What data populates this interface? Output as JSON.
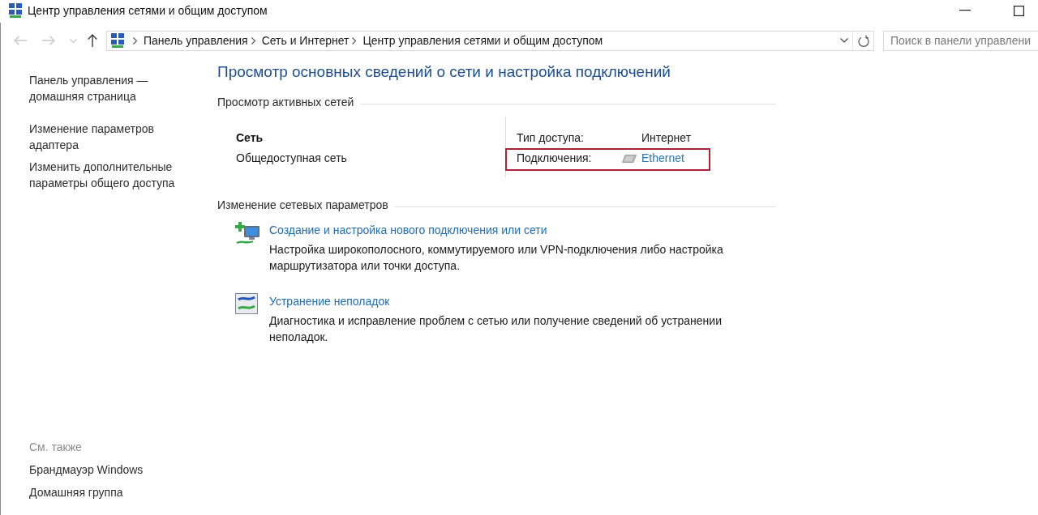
{
  "window": {
    "title": "Центр управления сетями и общим доступом"
  },
  "navigation": [
    {
      "kind": "back",
      "disabled": true
    },
    {
      "kind": "forward",
      "disabled": true
    },
    {
      "kind": "recent",
      "disabled": true
    },
    {
      "kind": "up",
      "disabled": false
    }
  ],
  "address_bar": {
    "breadcrumbs": [
      "Панель управления",
      "Сеть и Интернет",
      "Центр управления сетями и общим доступом"
    ]
  },
  "search": {
    "placeholder": "Поиск в панели управлени"
  },
  "sidebar": {
    "links": [
      "Панель управления — домашняя страница",
      "Изменение параметров адаптера",
      "Изменить дополнительные параметры общего доступа"
    ],
    "see_also": {
      "title": "См. также",
      "links": [
        "Брандмауэр Windows",
        "Домашняя группа"
      ]
    }
  },
  "main": {
    "title": "Просмотр основных сведений о сети и настройка подключений",
    "active_networks": {
      "heading": "Просмотр активных сетей",
      "network": {
        "name": "Сеть",
        "category": "Общедоступная сеть"
      },
      "properties": [
        {
          "label": "Тип доступа:",
          "value": "Интернет",
          "kind": "text",
          "highlighted": false
        },
        {
          "label": "Подключения:",
          "value": "Ethernet",
          "kind": "connection-link",
          "highlighted": true
        }
      ]
    },
    "change_settings": {
      "heading": "Изменение сетевых параметров",
      "tasks": [
        {
          "kind": "new-connection",
          "title": "Создание и настройка нового подключения или сети",
          "description": "Настройка широкополосного, коммутируемого или VPN-подключения либо настройка маршрутизатора или точки доступа."
        },
        {
          "kind": "troubleshoot",
          "title": "Устранение неполадок",
          "description": "Диагностика и исправление проблем с сетью или получение сведений об устранении неполадок."
        }
      ]
    }
  }
}
